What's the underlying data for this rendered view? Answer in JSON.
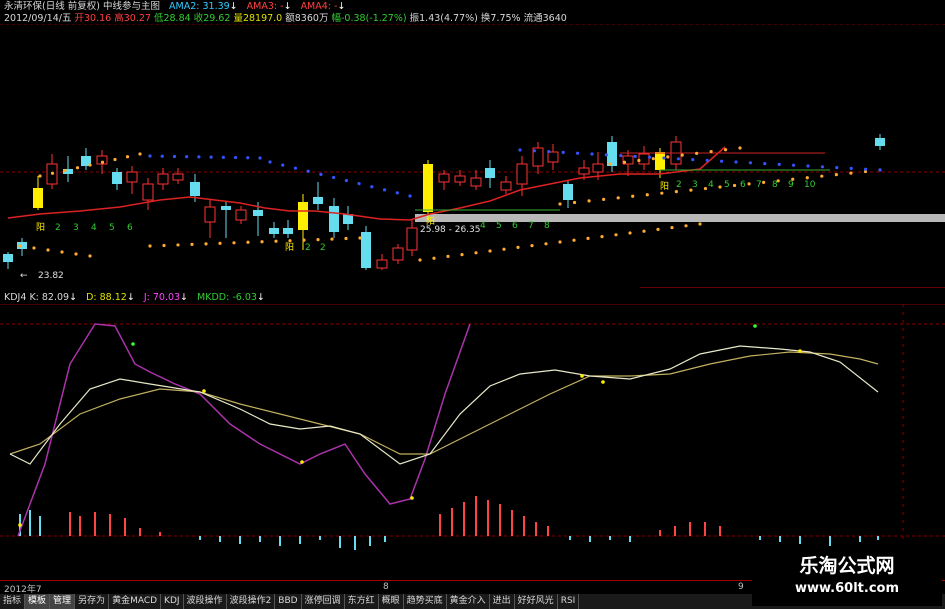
{
  "header": {
    "stock_title": "永清环保(日线 前复权)",
    "main_indicator": "中线参与主图",
    "ama2": "AMA2: 31.39",
    "ama3": "AMA3: -",
    "ama4": "AMA4: -",
    "date": "2012/09/14/五",
    "open": "开30.16",
    "high": "高30.27",
    "low": "低28.84",
    "close": "收29.62",
    "volume": "量28197.0",
    "amount": "额8360万",
    "change": "幅-0.38(-1.27%)",
    "amplitude": "振1.43(4.77%)",
    "turnover": "换7.75%",
    "float": "流通3640"
  },
  "kline": {
    "low_label": "23.82",
    "range_label": "25.98 - 26.35",
    "yang_marks": [
      "阳",
      "阳",
      "阳",
      "阳"
    ],
    "count_labels_a": [
      "2",
      "3",
      "4",
      "5",
      "6"
    ],
    "count_labels_b": [
      "2",
      "2"
    ],
    "count_labels_c": [
      "2",
      "3",
      "4",
      "5",
      "6",
      "7",
      "8",
      "9",
      "10"
    ],
    "count_labels_d": [
      "4",
      "5",
      "6",
      "7",
      "8"
    ]
  },
  "kdj": {
    "name": "KDJ4",
    "k": "K: 82.09",
    "d": "D: 88.12",
    "j": "J: 70.03",
    "mkdd": "MKDD: -6.03"
  },
  "date_axis": [
    "2012年7",
    "8",
    "9"
  ],
  "tabs": [
    "指标",
    "模板",
    "管理",
    "另存为",
    "黄金MACD",
    "KDJ",
    "波段操作",
    "波段操作2",
    "BBD",
    "涨停回调",
    "东方红",
    "概眼",
    "趋势买底",
    "黄金介入",
    "进出",
    "好好风光",
    "RSI"
  ],
  "active_tab": 2,
  "watermark": {
    "title": "乐淘公式网",
    "url": "www.60lt.com"
  },
  "colors": {
    "up": "#ff3333",
    "down": "#33ccff",
    "yellow": "#ffee00",
    "grid": "#880000",
    "k_line": "#aa33aa",
    "d_line": "#c0b060",
    "j_line": "#e0e0c0"
  }
}
